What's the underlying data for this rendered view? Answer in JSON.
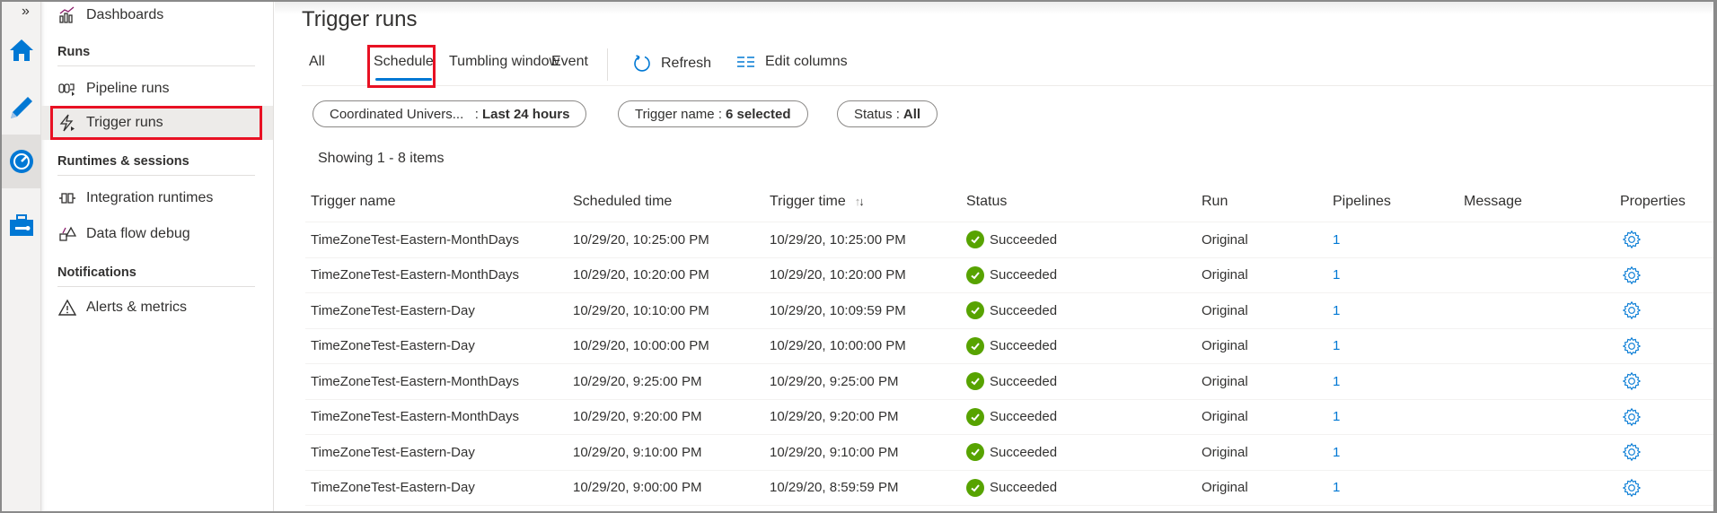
{
  "rail": {
    "expand_icon": "»",
    "items": [
      {
        "name": "home",
        "icon": "home-icon"
      },
      {
        "name": "author",
        "icon": "pencil-icon"
      },
      {
        "name": "monitor",
        "icon": "monitor-gauge-icon",
        "active": true
      },
      {
        "name": "manage",
        "icon": "toolbox-icon"
      }
    ]
  },
  "sidebar": {
    "items": {
      "dashboards": "Dashboards",
      "pipeline_runs": "Pipeline runs",
      "trigger_runs": "Trigger runs",
      "integration_runtimes": "Integration runtimes",
      "data_flow_debug": "Data flow debug",
      "alerts_metrics": "Alerts & metrics"
    },
    "sections": {
      "runs": "Runs",
      "runtimes": "Runtimes & sessions",
      "notifications": "Notifications"
    },
    "selected": "Trigger runs"
  },
  "page": {
    "title": "Trigger runs",
    "tabs": [
      "All",
      "Schedule",
      "Tumbling window",
      "Event"
    ],
    "active_tab": "Schedule",
    "commands": {
      "refresh": "Refresh",
      "edit_columns": "Edit columns"
    },
    "filters": {
      "time": {
        "label": "Coordinated Univers...",
        "sep": ":",
        "value": "Last 24 hours"
      },
      "trigger_name": {
        "label": "Trigger name",
        "sep": ":",
        "value": "6 selected"
      },
      "status": {
        "label": "Status",
        "sep": ":",
        "value": "All"
      }
    },
    "showing": "Showing 1 - 8 items"
  },
  "table": {
    "columns": [
      "Trigger name",
      "Scheduled time",
      "Trigger time",
      "Status",
      "Run",
      "Pipelines",
      "Message",
      "Properties"
    ],
    "sort_indicator": "↑↓",
    "rows": [
      {
        "name": "TimeZoneTest-Eastern-MonthDays",
        "scheduled": "10/29/20, 10:25:00 PM",
        "trigger": "10/29/20, 10:25:00 PM",
        "status": "Succeeded",
        "run": "Original",
        "pipelines": "1",
        "message": ""
      },
      {
        "name": "TimeZoneTest-Eastern-MonthDays",
        "scheduled": "10/29/20, 10:20:00 PM",
        "trigger": "10/29/20, 10:20:00 PM",
        "status": "Succeeded",
        "run": "Original",
        "pipelines": "1",
        "message": ""
      },
      {
        "name": "TimeZoneTest-Eastern-Day",
        "scheduled": "10/29/20, 10:10:00 PM",
        "trigger": "10/29/20, 10:09:59 PM",
        "status": "Succeeded",
        "run": "Original",
        "pipelines": "1",
        "message": ""
      },
      {
        "name": "TimeZoneTest-Eastern-Day",
        "scheduled": "10/29/20, 10:00:00 PM",
        "trigger": "10/29/20, 10:00:00 PM",
        "status": "Succeeded",
        "run": "Original",
        "pipelines": "1",
        "message": ""
      },
      {
        "name": "TimeZoneTest-Eastern-MonthDays",
        "scheduled": "10/29/20, 9:25:00 PM",
        "trigger": "10/29/20, 9:25:00 PM",
        "status": "Succeeded",
        "run": "Original",
        "pipelines": "1",
        "message": ""
      },
      {
        "name": "TimeZoneTest-Eastern-MonthDays",
        "scheduled": "10/29/20, 9:20:00 PM",
        "trigger": "10/29/20, 9:20:00 PM",
        "status": "Succeeded",
        "run": "Original",
        "pipelines": "1",
        "message": ""
      },
      {
        "name": "TimeZoneTest-Eastern-Day",
        "scheduled": "10/29/20, 9:10:00 PM",
        "trigger": "10/29/20, 9:10:00 PM",
        "status": "Succeeded",
        "run": "Original",
        "pipelines": "1",
        "message": ""
      },
      {
        "name": "TimeZoneTest-Eastern-Day",
        "scheduled": "10/29/20, 9:00:00 PM",
        "trigger": "10/29/20, 8:59:59 PM",
        "status": "Succeeded",
        "run": "Original",
        "pipelines": "1",
        "message": ""
      }
    ]
  },
  "colors": {
    "accent": "#0078d4",
    "success": "#57a300",
    "highlight": "#e81123"
  }
}
